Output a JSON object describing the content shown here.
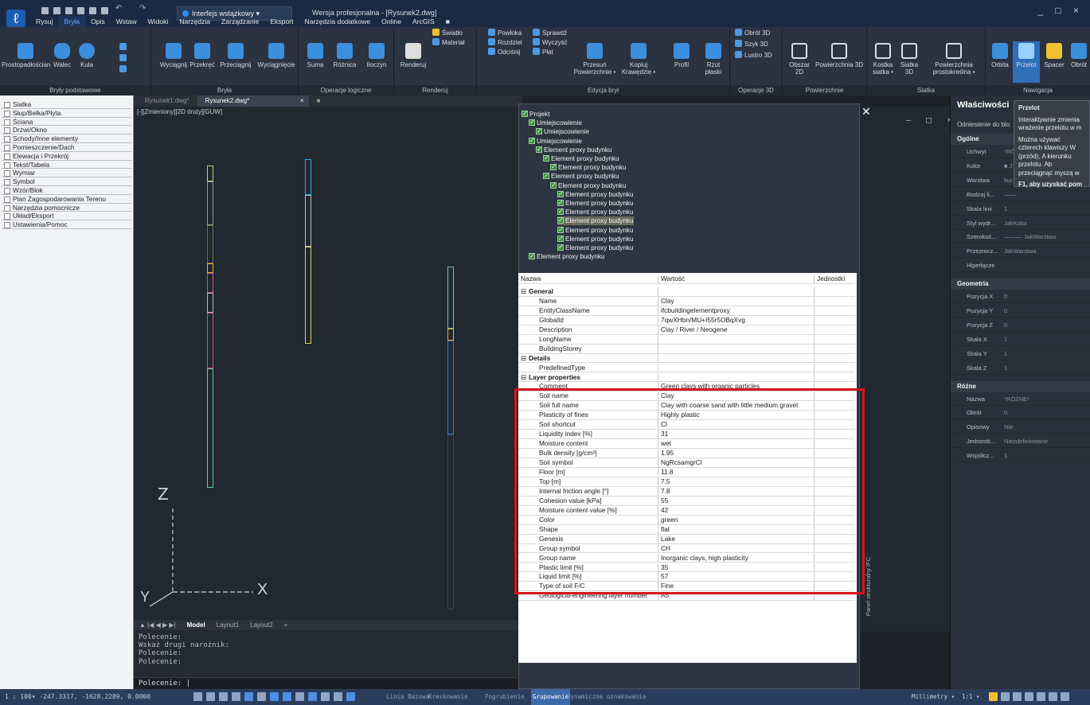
{
  "app": {
    "workspace": "Interfejs wstążkowy",
    "doc_title": "Wersja profesjonalna - [Rysunek2.dwg]",
    "window_controls": "_ □ ×"
  },
  "menu": [
    "Rysuj",
    "Bryła",
    "Opis",
    "Wstaw",
    "Widoki",
    "Narzędzia",
    "Zarządzanie",
    "Eksport",
    "Narzędzia dodatkowe",
    "Online",
    "ArcGIS"
  ],
  "ribbon": {
    "groups": [
      {
        "label": "Bryły podstawowe",
        "buttons": [
          "Prostopadłościan",
          "Walec",
          "Kula"
        ]
      },
      {
        "label": "Bryła",
        "buttons": [
          "Wyciągnij",
          "Przekręć",
          "Przeciągnij",
          "Wyciągnięcie"
        ]
      },
      {
        "label": "Operacje logiczne",
        "buttons": [
          "Suma",
          "Różnica",
          "Iloczyn"
        ]
      },
      {
        "label": "Renderuj",
        "buttons": [
          "Renderuj"
        ],
        "small": [
          "Światło",
          "Materiał"
        ]
      },
      {
        "label": "Edycja brył",
        "small": [
          "Powłoka",
          "Sprawdź",
          "Rozdziel",
          "Wyczyść",
          "Odciśnij",
          "Płat"
        ],
        "buttons": [
          "Przesuń Powierzchnie •",
          "Kopiuj Krawędzie •",
          "Profil",
          "Rzut płaski"
        ]
      },
      {
        "label": "Operacje 3D",
        "small": [
          "Obrót 3D",
          "Szyk 3D",
          "Lustro 3D"
        ]
      },
      {
        "label": "Powierzchnie",
        "buttons": [
          "Obszar 2D",
          "Powierzchnia 3D"
        ]
      },
      {
        "label": "Siatka",
        "buttons": [
          "Kostka siatka •",
          "Siatka 3D",
          "Powierzchnia prostokreślna •"
        ]
      },
      {
        "label": "Nawigacja",
        "buttons": [
          "Orbita",
          "Przelot",
          "Spacer",
          "Obrót"
        ]
      }
    ]
  },
  "left_panel": {
    "items": [
      "Siatka",
      "Słup/Belka/Płyta",
      "Ściana",
      "Drzwi/Okno",
      "Schody/Inne elementy",
      "Pomieszczenie/Dach",
      "Elewacja i Przekrój",
      "Tekst/Tabela",
      "Wymiar",
      "Symbol",
      "Wzór/Blok",
      "Plan Zagospodarowania Terenu",
      "Narzędzia pomocnicze",
      "Układ/Eksport",
      "Ustawienia/Pomoc"
    ]
  },
  "doc_tabs": [
    "Rysunek1.dwg*",
    "Rysunek2.dwg*"
  ],
  "viewport": {
    "label": "[-][Zmieniony][2D druty][GUW]",
    "axis_z": "Z",
    "axis_x": "X",
    "axis_y": "Y"
  },
  "layout_tabs": [
    "Model",
    "Layout1",
    "Layout2",
    "+"
  ],
  "command": {
    "history": [
      "Polecenie:",
      "Wskaż drugi narożnik:",
      "Polecenie:",
      "Polecenie:"
    ],
    "prompt": "Polecenie:"
  },
  "ifc_panel": {
    "side_label": "Panel strukturalny IFC",
    "tree": [
      {
        "label": "Projekt",
        "depth": 0
      },
      {
        "label": "Umiejscowienie",
        "depth": 1
      },
      {
        "label": "Umiejscowienie",
        "depth": 2
      },
      {
        "label": "Umiejscowienie",
        "depth": 1
      },
      {
        "label": "Element proxy budynku",
        "depth": 2
      },
      {
        "label": "Element proxy budynku",
        "depth": 3
      },
      {
        "label": "Element proxy budynku",
        "depth": 4
      },
      {
        "label": "Element proxy budynku",
        "depth": 3
      },
      {
        "label": "Element proxy budynku",
        "depth": 4
      },
      {
        "label": "Element proxy budynku",
        "depth": 5
      },
      {
        "label": "Element proxy budynku",
        "depth": 5
      },
      {
        "label": "Element proxy budynku",
        "depth": 5
      },
      {
        "label": "Element proxy budynku",
        "depth": 5
      },
      {
        "label": "Element proxy budynku",
        "depth": 5
      },
      {
        "label": "Element proxy budynku",
        "depth": 5
      },
      {
        "label": "Element proxy budynku",
        "depth": 5
      },
      {
        "label": "Element proxy budynku",
        "depth": 1
      }
    ],
    "table_header": [
      "Nazwa",
      "Wartość",
      "Jednostki"
    ],
    "rows": [
      {
        "type": "section",
        "name": "General"
      },
      {
        "name": "Name",
        "value": "Clay"
      },
      {
        "name": "EntityClassName",
        "value": "ifcbuildingelementproxy"
      },
      {
        "name": "GlobalId",
        "value": "7qwXHbn/MU+I55r5OBqXvg"
      },
      {
        "name": "Description",
        "value": "Clay / River / Neogene"
      },
      {
        "name": "LongName",
        "value": ""
      },
      {
        "name": "BuildingStorey",
        "value": ""
      },
      {
        "type": "section",
        "name": "Details"
      },
      {
        "name": "PredefinedType",
        "value": ""
      },
      {
        "type": "section",
        "name": "Layer properties"
      },
      {
        "name": "Comment",
        "value": "Green clays with organic particles"
      },
      {
        "name": "Soil name",
        "value": "Clay"
      },
      {
        "name": "Soil full name",
        "value": "Clay with coarse sand with little medium gravel"
      },
      {
        "name": "Plasticity of fines",
        "value": "Highly plastic"
      },
      {
        "name": "Soil shortcut",
        "value": "Cl"
      },
      {
        "name": "Liquidity index [%]",
        "value": "31"
      },
      {
        "name": "Moisture content",
        "value": "wet"
      },
      {
        "name": "Bulk density [g/cm³]",
        "value": "1.95"
      },
      {
        "name": "Soil symbol",
        "value": "NgRcsamgrCl"
      },
      {
        "name": "Floor [m]",
        "value": "11.8"
      },
      {
        "name": "Top [m]",
        "value": "7.5"
      },
      {
        "name": "Internal friction angle [°]",
        "value": "7.8"
      },
      {
        "name": "Cohesion value [kPa]",
        "value": "55"
      },
      {
        "name": "Moisture content value [%]",
        "value": "42"
      },
      {
        "name": "Color",
        "value": "green"
      },
      {
        "name": "Shape",
        "value": "flat"
      },
      {
        "name": "Genesis",
        "value": "Lake"
      },
      {
        "name": "Group symbol",
        "value": "CH"
      },
      {
        "name": "Group name",
        "value": "Inorganic clays, high plasticity"
      },
      {
        "name": "Plastic limit [%]",
        "value": "35"
      },
      {
        "name": "Liquid limit [%]",
        "value": "57"
      },
      {
        "name": "Type of soil F/C",
        "value": "Fine"
      },
      {
        "name": "Geological-engineering layer number",
        "value": "A5"
      }
    ],
    "highlight_color": "#d6161c"
  },
  "properties": {
    "title": "Właściwości",
    "subtitle": "Odniesienie do blo",
    "sections": [
      {
        "title": "Ogólne",
        "rows": [
          [
            "Uchwyt",
            "*RÓ"
          ],
          [
            "Kolor",
            "■ J"
          ],
          [
            "Warstwa",
            "bui"
          ],
          [
            "Rodzaj li...",
            "——"
          ],
          [
            "Skala linii",
            "1"
          ],
          [
            "Styl wydr...",
            "JakKolor"
          ],
          [
            "Szerokoś...",
            "——— JakWarstwa"
          ],
          [
            "Przezrocz...",
            "JakWarstwa"
          ],
          [
            "Hiperłącze",
            ""
          ]
        ]
      },
      {
        "title": "Geometria",
        "rows": [
          [
            "Pozycja X",
            "0"
          ],
          [
            "Pozycja Y",
            "0"
          ],
          [
            "Pozycja Z",
            "0"
          ],
          [
            "Skala X",
            "1"
          ],
          [
            "Skala Y",
            "1"
          ],
          [
            "Skala Z",
            "1"
          ]
        ]
      },
      {
        "title": "Różne",
        "rows": [
          [
            "Nazwa",
            "*RÓŻNE*"
          ],
          [
            "Obrót",
            "0"
          ],
          [
            "Opisowy",
            "Nie"
          ],
          [
            "Jednostk...",
            "Niezdefiniowane"
          ],
          [
            "Współcz...",
            "1"
          ]
        ]
      }
    ]
  },
  "tooltip": {
    "title": "Przelot",
    "line1": "Interaktywnie zmienia wrażenie przelotu w m",
    "line2": "Można używać czterech klawiszy W (przód), A kierunku przelotu. Ab przeciągnąć myszą w",
    "line3": "F1, aby uzyskać pom"
  },
  "statusbar": {
    "coords": "1 : 100▾  -247.3317, -1628.2289, 0.0000",
    "toggles": [
      "Linia Bazowa",
      "Kreskowanie",
      "Pogrubienie",
      "Grupowanie",
      "Dynamiczne oznakowanie"
    ],
    "active_toggle": "Grupowanie",
    "units": "Millimetry ▾",
    "scale": "1:1 ▾"
  }
}
